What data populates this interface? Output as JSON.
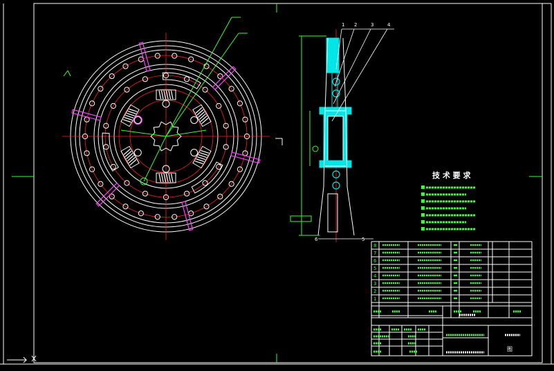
{
  "drawing": {
    "background": "#000000",
    "colors": {
      "frame": "#ffffff",
      "centerline": "#ff2020",
      "leader": "#33ff33",
      "section": "#00e5e5",
      "spring": "#ffffff",
      "highlight": "#ff40ff",
      "table_text": "#33ff33",
      "heading_text": "#ffffff"
    },
    "view_labels": {
      "front_view_mark": "⌐ſ",
      "cut_mark": "┐",
      "item_circle": "①",
      "left_label": "⊿"
    },
    "leader_labels": [
      "",
      ""
    ],
    "part_numbers": [
      "1",
      "2",
      "3",
      "4"
    ],
    "bottom_part_numbers": [
      "6",
      "5"
    ],
    "tech_requirements": {
      "title": "技 术 要 求",
      "lines": [
        "",
        "",
        "",
        "",
        "",
        "",
        ""
      ]
    },
    "parts_list": {
      "rows": [
        {
          "no": "8"
        },
        {
          "no": "7"
        },
        {
          "no": "6"
        },
        {
          "no": "5"
        },
        {
          "no": "4"
        },
        {
          "no": "3"
        },
        {
          "no": "2"
        },
        {
          "no": "1"
        }
      ],
      "header": [
        "",
        "",
        "",
        "",
        ""
      ]
    },
    "title_block": {
      "drawing_name": "",
      "scale_text": "",
      "sheet_text": "",
      "sign": "图"
    }
  }
}
